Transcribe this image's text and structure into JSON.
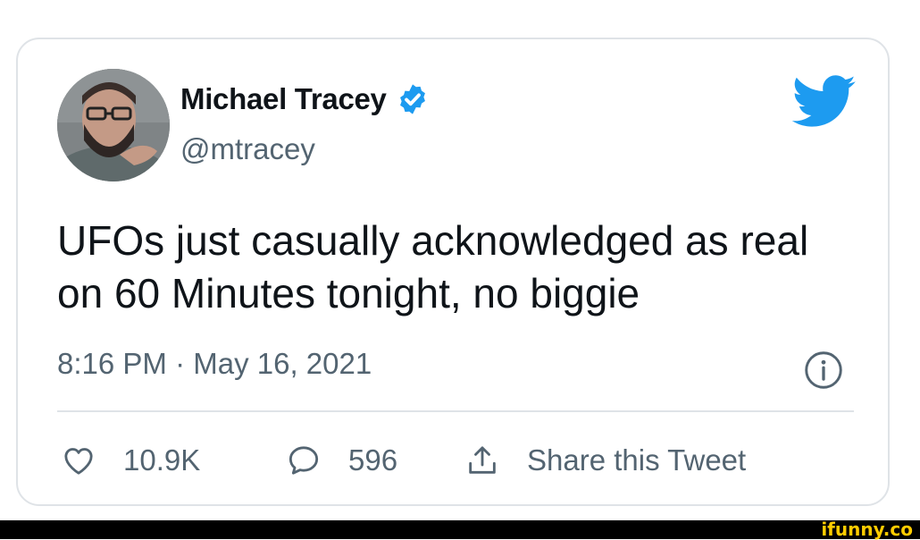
{
  "tweet": {
    "display_name": "Michael Tracey",
    "handle": "@mtracey",
    "text": "UFOs just casually acknowledged as real on 60 Minutes tonight, no biggie",
    "timestamp": "8:16 PM · May 16, 2021",
    "verified": true
  },
  "actions": {
    "like_count": "10.9K",
    "reply_count": "596",
    "share_label": "Share this Tweet"
  },
  "icons": {
    "verified": "verified-badge-icon",
    "brand": "twitter-bird-icon",
    "info": "info-icon",
    "like": "heart-icon",
    "reply": "speech-bubble-icon",
    "share": "share-upload-icon"
  },
  "colors": {
    "twitter_blue": "#1d9bf0",
    "text_primary": "#0f1419",
    "text_secondary": "#536471",
    "border": "#dfe3e7",
    "watermark": "#ffcc00"
  },
  "watermark": {
    "text": "ifunny.co"
  }
}
